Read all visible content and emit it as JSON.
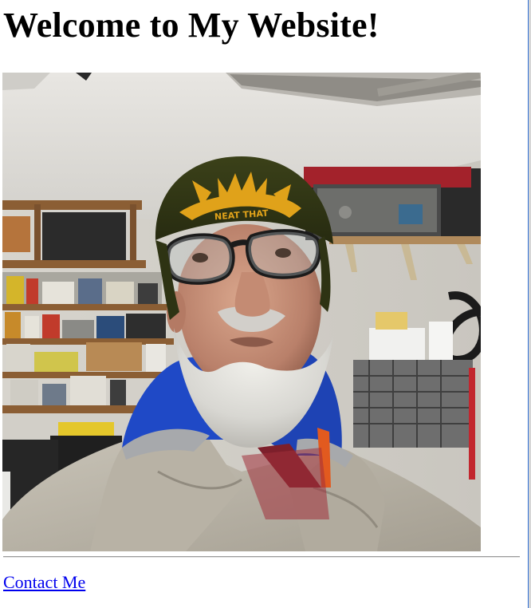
{
  "page": {
    "heading": "Welcome to My Website!",
    "photo_alt": "Portrait photo",
    "contact_link": "Contact Me",
    "hat_text": "NEAT THAT"
  },
  "colors": {
    "link": "#0000ee",
    "text": "#000000",
    "hat": "#2f3516",
    "hat_logo": "#e0a21a",
    "jacket": "#b9b3a6",
    "hoodie": "#1f49c6",
    "beard": "#d8d7d2"
  },
  "icons": {
    "photo": "person-portrait"
  }
}
